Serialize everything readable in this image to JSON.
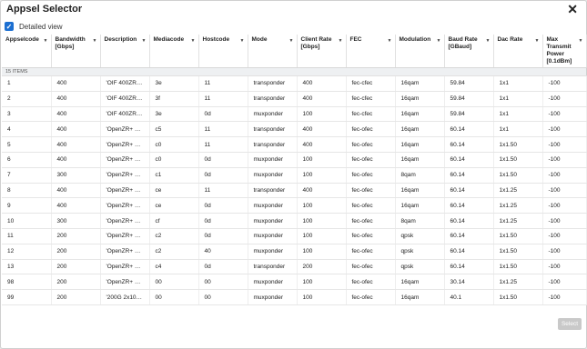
{
  "dialog": {
    "title": "Appsel Selector",
    "close_glyph": "✕"
  },
  "detailed_view": {
    "label": "Detailed view",
    "checked": true
  },
  "table": {
    "columns": [
      "Appselcode",
      "Bandwidth [Gbps]",
      "Description",
      "Mediacode",
      "Hostcode",
      "Mode",
      "Client Rate [Gbps]",
      "FEC",
      "Modulation",
      "Baud Rate [GBaud]",
      "Dac Rate",
      "Max Transmit Power [0.1dBm]"
    ],
    "count_label": "15 ITEMS",
    "rows": [
      [
        "1",
        "400",
        "'OIF 400ZR 1...",
        "3e",
        "11",
        "transponder",
        "400",
        "fec-cfec",
        "16qam",
        "59.84",
        "1x1",
        "-100"
      ],
      [
        "2",
        "400",
        "'OIF 400ZR 1...",
        "3f",
        "11",
        "transponder",
        "400",
        "fec-cfec",
        "16qam",
        "59.84",
        "1x1",
        "-100"
      ],
      [
        "3",
        "400",
        "'OIF 400ZR 4...",
        "3e",
        "0d",
        "muxponder",
        "100",
        "fec-cfec",
        "16qam",
        "59.84",
        "1x1",
        "-100"
      ],
      [
        "4",
        "400",
        "'OpenZR+ 1x...",
        "c5",
        "11",
        "transponder",
        "400",
        "fec-ofec",
        "16qam",
        "60.14",
        "1x1",
        "-100"
      ],
      [
        "5",
        "400",
        "'OpenZR+ 1x...",
        "c0",
        "11",
        "transponder",
        "400",
        "fec-ofec",
        "16qam",
        "60.14",
        "1x1.50",
        "-100"
      ],
      [
        "6",
        "400",
        "'OpenZR+ 4x...",
        "c0",
        "0d",
        "muxponder",
        "100",
        "fec-ofec",
        "16qam",
        "60.14",
        "1x1.50",
        "-100"
      ],
      [
        "7",
        "300",
        "'OpenZR+ 3x...",
        "c1",
        "0d",
        "muxponder",
        "100",
        "fec-ofec",
        "8qam",
        "60.14",
        "1x1.50",
        "-100"
      ],
      [
        "8",
        "400",
        "'OpenZR+ 1x...",
        "ce",
        "11",
        "transponder",
        "400",
        "fec-ofec",
        "16qam",
        "60.14",
        "1x1.25",
        "-100"
      ],
      [
        "9",
        "400",
        "'OpenZR+ 4x...",
        "ce",
        "0d",
        "muxponder",
        "100",
        "fec-ofec",
        "16qam",
        "60.14",
        "1x1.25",
        "-100"
      ],
      [
        "10",
        "300",
        "'OpenZR+ 3x...",
        "cf",
        "0d",
        "muxponder",
        "100",
        "fec-ofec",
        "8qam",
        "60.14",
        "1x1.25",
        "-100"
      ],
      [
        "11",
        "200",
        "'OpenZR+ 2x...",
        "c2",
        "0d",
        "muxponder",
        "100",
        "fec-ofec",
        "qpsk",
        "60.14",
        "1x1.50",
        "-100"
      ],
      [
        "12",
        "200",
        "'OpenZR+ 2x...",
        "c2",
        "40",
        "muxponder",
        "100",
        "fec-ofec",
        "qpsk",
        "60.14",
        "1x1.50",
        "-100"
      ],
      [
        "13",
        "200",
        "'OpenZR+ 1x...",
        "c4",
        "0d",
        "transponder",
        "200",
        "fec-ofec",
        "qpsk",
        "60.14",
        "1x1.50",
        "-100"
      ],
      [
        "98",
        "200",
        "'OpenZR+ 1x...",
        "00",
        "00",
        "muxponder",
        "100",
        "fec-ofec",
        "16qam",
        "30.14",
        "1x1.25",
        "-100"
      ],
      [
        "99",
        "200",
        "'200G 2x100...",
        "00",
        "00",
        "muxponder",
        "100",
        "fec-ofec",
        "16qam",
        "40.1",
        "1x1.50",
        "-100"
      ]
    ]
  },
  "footer": {
    "select_label": "Select"
  },
  "colors": {
    "accent": "#1c6fd1",
    "disabled_button": "#c9c9c9"
  }
}
